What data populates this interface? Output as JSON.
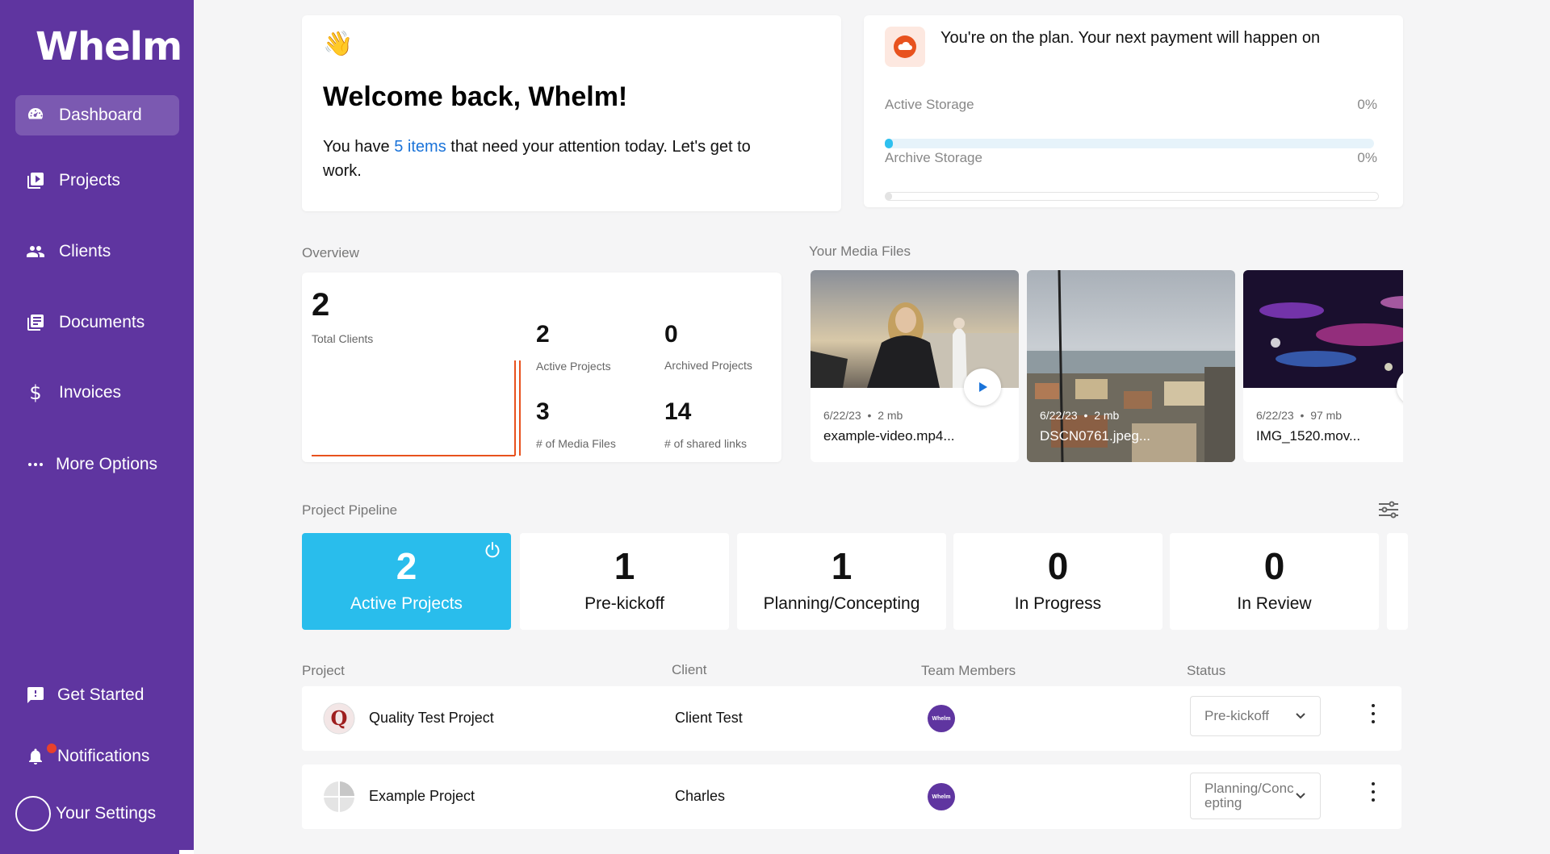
{
  "app": {
    "logo": "Whelm"
  },
  "sidebar": {
    "items": [
      {
        "label": "Dashboard",
        "icon": "dashboard-icon",
        "active": true
      },
      {
        "label": "Projects",
        "icon": "projects-icon"
      },
      {
        "label": "Clients",
        "icon": "clients-icon"
      },
      {
        "label": "Documents",
        "icon": "documents-icon"
      },
      {
        "label": "Invoices",
        "icon": "dollar-icon"
      },
      {
        "label": "More Options",
        "icon": "more-icon"
      }
    ],
    "bottom": [
      {
        "label": "Get Started",
        "icon": "get-started-icon"
      },
      {
        "label": "Notifications",
        "icon": "bell-icon",
        "has_unread": true
      },
      {
        "label": "Your Settings",
        "icon": "avatar"
      }
    ]
  },
  "welcome": {
    "emoji": "👋",
    "title": "Welcome back, Whelm!",
    "text_before": "You have ",
    "link": "5 items",
    "text_after": " that need your attention today. Let's get to work."
  },
  "plan": {
    "text": "You're on the  plan. Your next payment will happen on",
    "active_storage_label": "Active Storage",
    "active_storage_pct": "0%",
    "archive_storage_label": "Archive Storage",
    "archive_storage_pct": "0%",
    "accent": "#e8521e"
  },
  "overview": {
    "label": "Overview",
    "total_clients": "2",
    "total_clients_label": "Total Clients",
    "active_projects": "2",
    "active_projects_label": "Active Projects",
    "archived_projects": "0",
    "archived_projects_label": "Archived Projects",
    "media_files": "3",
    "media_files_label": "# of Media Files",
    "shared_links": "14",
    "shared_links_label": "# of shared links"
  },
  "media": {
    "label": "Your Media Files",
    "files": [
      {
        "date": "6/22/23",
        "size": "2 mb",
        "name": "example-video.mp4..."
      },
      {
        "date": "6/22/23",
        "size": "2 mb",
        "name": "DSCN0761.jpeg..."
      },
      {
        "date": "6/22/23",
        "size": "97 mb",
        "name": "IMG_1520.mov..."
      }
    ]
  },
  "pipeline": {
    "label": "Project Pipeline",
    "stages": [
      {
        "count": "2",
        "label": "Active Projects"
      },
      {
        "count": "1",
        "label": "Pre-kickoff"
      },
      {
        "count": "1",
        "label": "Planning/Concepting"
      },
      {
        "count": "0",
        "label": "In Progress"
      },
      {
        "count": "0",
        "label": "In Review"
      }
    ],
    "active_color": "#29bdec"
  },
  "table": {
    "headers": {
      "project": "Project",
      "client": "Client",
      "team": "Team Members",
      "status": "Status"
    },
    "rows": [
      {
        "project": "Quality Test Project",
        "client": "Client Test",
        "member": "Whelm",
        "status": "Pre-kickoff"
      },
      {
        "project": "Example Project",
        "client": "Charles",
        "member": "Whelm",
        "status": "Planning/Concepting"
      }
    ]
  }
}
